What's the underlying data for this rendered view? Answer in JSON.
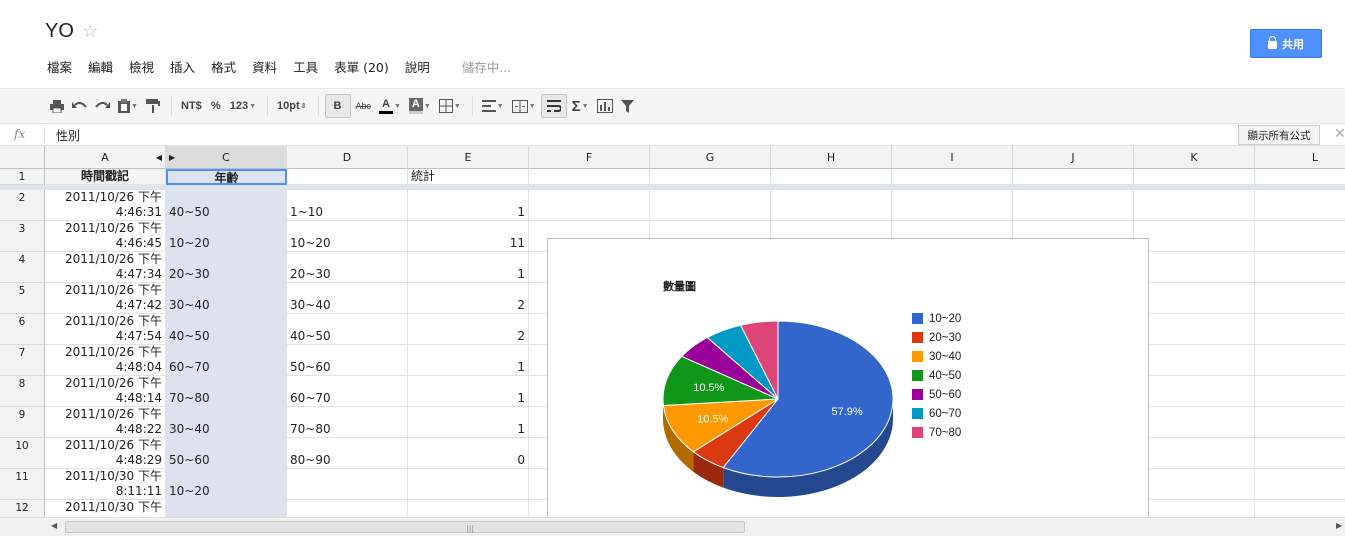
{
  "header": {
    "title": "YO",
    "star_icon": "star-icon",
    "menu": [
      "檔案",
      "編輯",
      "檢視",
      "插入",
      "格式",
      "資料",
      "工具",
      "表單 (20)",
      "說明"
    ],
    "saving_status": "儲存中...",
    "share_label": "共用"
  },
  "toolbar": {
    "currency": "NT$",
    "percent": "%",
    "number_format": "123",
    "font_size": "10pt",
    "bold": "B",
    "strikethrough": "Abc",
    "text_color": "A",
    "fill_color": "A",
    "sum": "Σ"
  },
  "formula_bar": {
    "fx": "fx",
    "value": "性別",
    "show_formulas": "顯示所有公式",
    "close": "✕"
  },
  "columns": [
    "A",
    "C",
    "D",
    "E",
    "F",
    "G",
    "H",
    "I",
    "J",
    "K",
    "L"
  ],
  "rows": [
    {
      "num": "1",
      "a": "時間戳記",
      "c": "年齡",
      "d": "",
      "e": "統計"
    },
    {
      "num": "2",
      "a1": "2011/10/26 下午",
      "a2": "4:46:31",
      "c": "40~50",
      "d": "1~10",
      "e": "1"
    },
    {
      "num": "3",
      "a1": "2011/10/26 下午",
      "a2": "4:46:45",
      "c": "10~20",
      "d": "10~20",
      "e": "11"
    },
    {
      "num": "4",
      "a1": "2011/10/26 下午",
      "a2": "4:47:34",
      "c": "20~30",
      "d": "20~30",
      "e": "1"
    },
    {
      "num": "5",
      "a1": "2011/10/26 下午",
      "a2": "4:47:42",
      "c": "30~40",
      "d": "30~40",
      "e": "2"
    },
    {
      "num": "6",
      "a1": "2011/10/26 下午",
      "a2": "4:47:54",
      "c": "40~50",
      "d": "40~50",
      "e": "2"
    },
    {
      "num": "7",
      "a1": "2011/10/26 下午",
      "a2": "4:48:04",
      "c": "60~70",
      "d": "50~60",
      "e": "1"
    },
    {
      "num": "8",
      "a1": "2011/10/26 下午",
      "a2": "4:48:14",
      "c": "70~80",
      "d": "60~70",
      "e": "1"
    },
    {
      "num": "9",
      "a1": "2011/10/26 下午",
      "a2": "4:48:22",
      "c": "30~40",
      "d": "70~80",
      "e": "1"
    },
    {
      "num": "10",
      "a1": "2011/10/26 下午",
      "a2": "4:48:29",
      "c": "50~60",
      "d": "80~90",
      "e": "0"
    },
    {
      "num": "11",
      "a1": "2011/10/30 下午",
      "a2": "8:11:11",
      "c": "10~20",
      "d": "",
      "e": ""
    },
    {
      "num": "12",
      "a1": "2011/10/30 下午",
      "a2": "",
      "c": "",
      "d": "",
      "e": ""
    }
  ],
  "chart_data": {
    "type": "pie",
    "title": "數量圖",
    "categories": [
      "10~20",
      "20~30",
      "30~40",
      "40~50",
      "50~60",
      "60~70",
      "70~80"
    ],
    "values": [
      11,
      1,
      2,
      2,
      1,
      1,
      1
    ],
    "colors": [
      "#3366cc",
      "#dc3912",
      "#ff9900",
      "#109618",
      "#990099",
      "#0099c6",
      "#dd4477"
    ],
    "slice_labels": [
      "57.9%",
      "",
      "10.5%",
      "10.5%",
      "",
      "",
      ""
    ],
    "legend_position": "right",
    "is3D": true
  }
}
